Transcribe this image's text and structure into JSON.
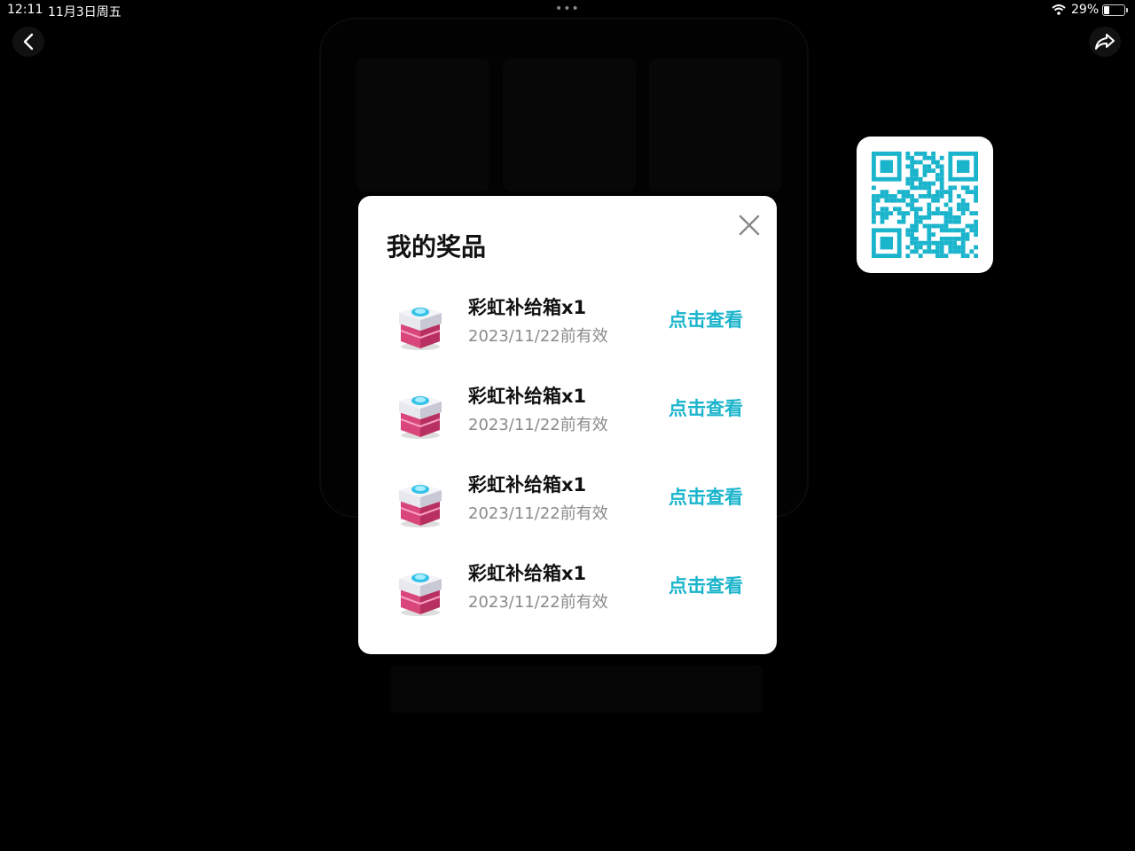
{
  "status_bar": {
    "time": "12:11",
    "date": "11月3日周五",
    "battery": "29%"
  },
  "modal": {
    "title": "我的奖品",
    "prizes": [
      {
        "name": "彩虹补给箱x1",
        "expiry": "2023/11/22前有效",
        "action": "点击查看",
        "icon": "supply-box-icon"
      },
      {
        "name": "彩虹补给箱x1",
        "expiry": "2023/11/22前有效",
        "action": "点击查看",
        "icon": "supply-box-icon"
      },
      {
        "name": "彩虹补给箱x1",
        "expiry": "2023/11/22前有效",
        "action": "点击查看",
        "icon": "supply-box-icon"
      },
      {
        "name": "彩虹补给箱x1",
        "expiry": "2023/11/22前有效",
        "action": "点击查看",
        "icon": "supply-box-icon"
      }
    ]
  },
  "colors": {
    "accent": "#1ab4cc",
    "qr": "#1ab4cc",
    "overlay": "#000000"
  }
}
